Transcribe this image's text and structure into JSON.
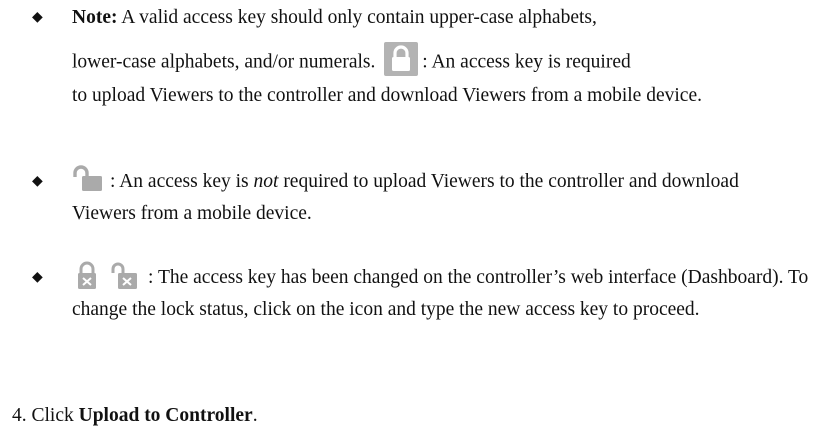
{
  "bullets": [
    {
      "note_label": "Note:",
      "line1": " A valid access key should only contain upper-case alphabets,",
      "line2_before": "lower-case alphabets, and/or numerals. ",
      "line2_after": ": An access key is required",
      "rest": "to upload Viewers to the controller and download Viewers from a mobile device.",
      "icon": "lock-closed-icon"
    },
    {
      "text_before": ": An access key is ",
      "emph": "not",
      "text_after": " required to upload Viewers to the controller and download Viewers from a mobile device.",
      "icon": "lock-open-icon"
    },
    {
      "text": ": The access key has been changed on the controller’s web interface (Dashboard). To change the lock status, click on the icon and type the new access key to proceed.",
      "icons": [
        "lock-closed-x-icon",
        "lock-open-x-icon"
      ]
    }
  ],
  "step": {
    "number": "4.",
    "text_before": " Click ",
    "bold": "Upload to Controller",
    "text_after": "."
  },
  "colors": {
    "icon_gray": "#b3b3b3",
    "icon_dark": "#888888"
  }
}
